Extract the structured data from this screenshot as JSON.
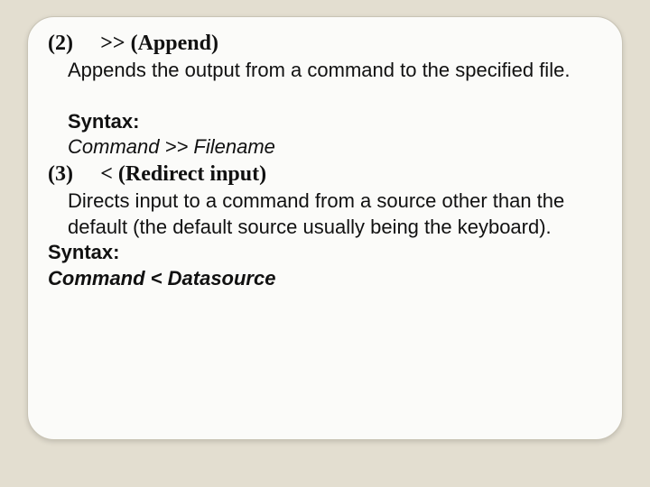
{
  "item2": {
    "num": "(2)",
    "op": ">> (Append)",
    "desc": "Appends the output from a command to the specified file.",
    "synlabel": "Syntax:",
    "syntax": "Command >> Filename"
  },
  "item3": {
    "num": "(3)",
    "op": "< (Redirect input)",
    "desc": "Directs input to a command from a source other than the default (the default source usually being the keyboard).",
    "synlabel": "Syntax:",
    "syntax": "Command < Datasource"
  }
}
